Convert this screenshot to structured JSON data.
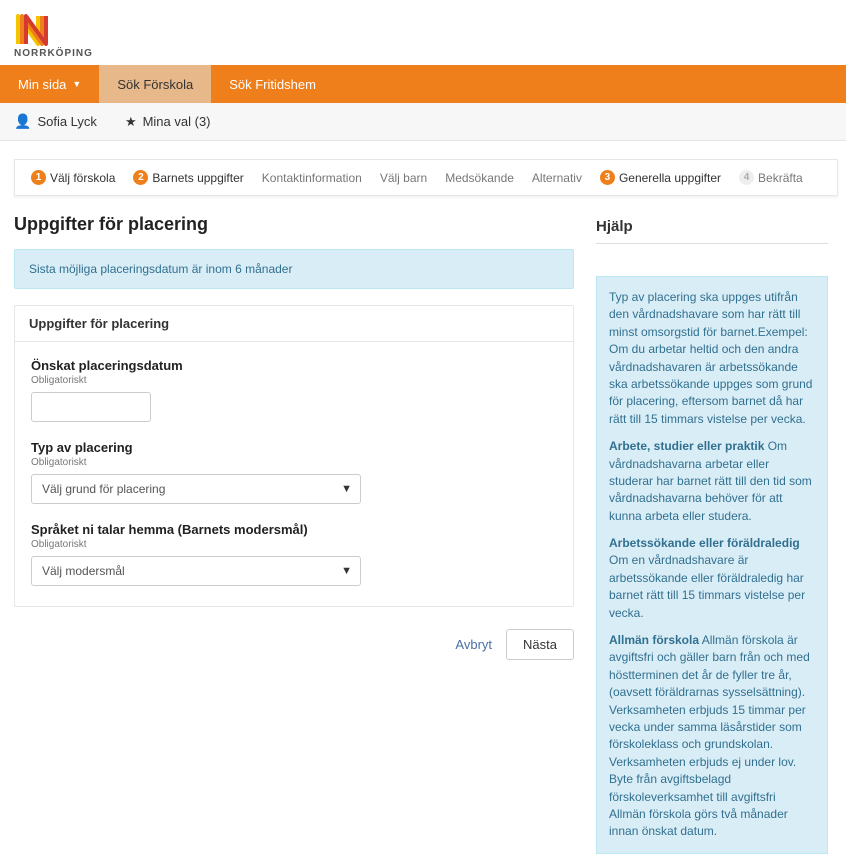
{
  "brand": {
    "name": "NORRKÖPING"
  },
  "nav": {
    "items": [
      {
        "label": "Min sida"
      },
      {
        "label": "Sök Förskola"
      },
      {
        "label": "Sök Fritidshem"
      }
    ]
  },
  "subbar": {
    "username": "Sofia Lyck",
    "favorites_label": "Mina val (3)"
  },
  "stepper": {
    "steps": [
      {
        "num": "1",
        "label": "Välj förskola"
      },
      {
        "num": "2",
        "label": "Barnets uppgifter"
      },
      {
        "num": "",
        "label": "Kontaktinformation"
      },
      {
        "num": "",
        "label": "Välj barn"
      },
      {
        "num": "",
        "label": "Medsökande"
      },
      {
        "num": "",
        "label": "Alternativ"
      },
      {
        "num": "3",
        "label": "Generella uppgifter"
      },
      {
        "num": "4",
        "label": "Bekräfta"
      }
    ]
  },
  "page": {
    "title": "Uppgifter för placering",
    "info": "Sista möjliga placeringsdatum är inom 6 månader"
  },
  "panel": {
    "header": "Uppgifter för placering",
    "date_label": "Önskat placeringsdatum",
    "date_hint": "Obligatoriskt",
    "date_value": "",
    "type_label": "Typ av placering",
    "type_hint": "Obligatoriskt",
    "type_selected": "Välj grund för placering",
    "lang_label": "Språket ni talar hemma (Barnets modersmål)",
    "lang_hint": "Obligatoriskt",
    "lang_selected": "Välj modersmål"
  },
  "actions": {
    "cancel": "Avbryt",
    "next": "Nästa"
  },
  "help": {
    "title": "Hjälp",
    "p1": "Typ av placering ska uppges utifrån den vårdnadshavare som har rätt till minst omsorgstid för barnet.Exempel: Om du arbetar heltid och den andra vårdnadshavaren är arbetssökande ska arbetssökande uppges som grund för placering, eftersom barnet då har rätt till 15 timmars vistelse per vecka.",
    "p2a": "Arbete, studier eller praktik",
    "p2b": " Om vårdnadshavarna arbetar eller studerar har barnet rätt till den tid som vårdnadshavarna behöver för att kunna arbeta eller studera.",
    "p3a": "Arbetssökande eller föräldraledig",
    "p3b": " Om en vårdnadshavare är arbetssökande eller föräldraledig har barnet rätt till 15 timmars vistelse per vecka.",
    "p4a": "Allmän förskola",
    "p4b": " Allmän förskola är avgiftsfri och gäller barn från och med höstterminen det år de fyller tre år, (oavsett föräldrarnas sysselsättning). Verksamheten erbjuds 15 timmar per vecka under samma läsårstider som förskoleklass och grundskolan. Verksamheten erbjuds ej under lov. Byte från avgiftsbelagd förskoleverksamhet till avgiftsfri Allmän förskola görs två månader innan önskat datum."
  }
}
